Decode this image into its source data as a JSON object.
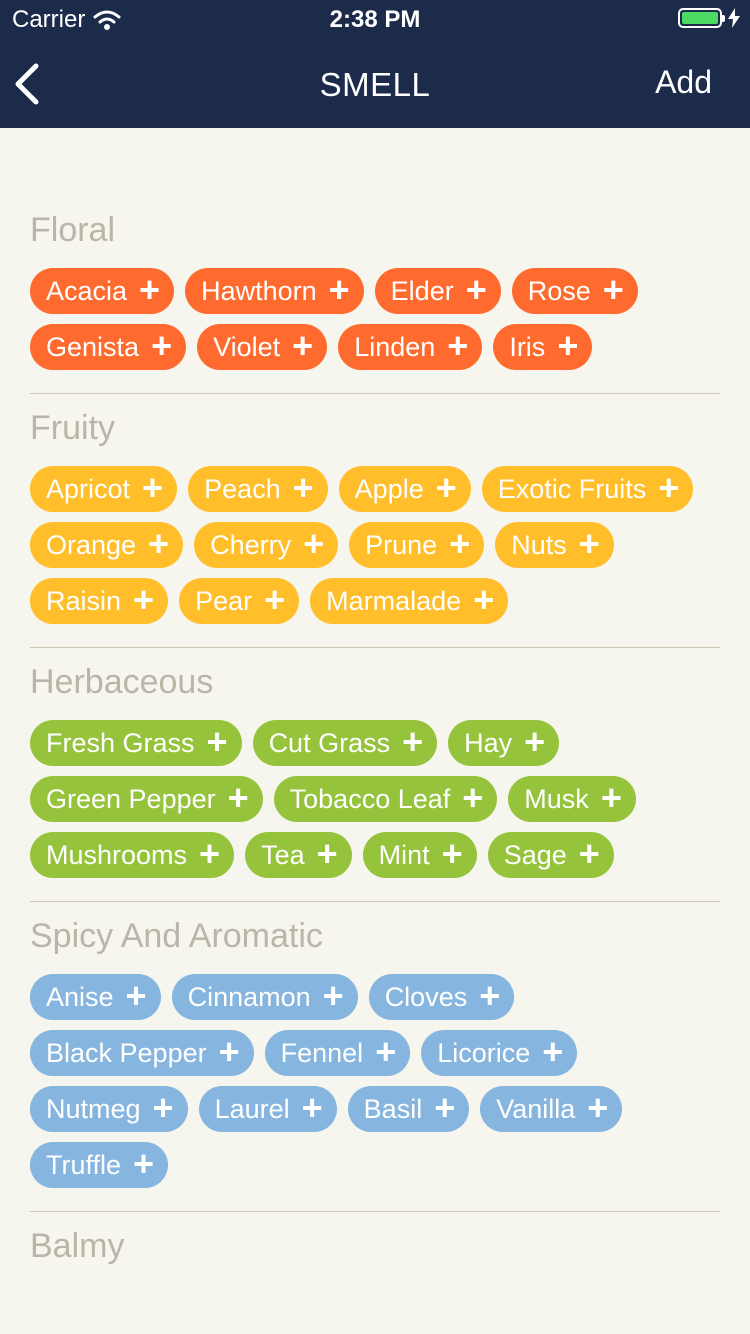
{
  "status_bar": {
    "carrier": "Carrier",
    "time": "2:38 PM",
    "battery_level": 1.0,
    "battery_color": "#4cd964"
  },
  "nav": {
    "title": "SMELL",
    "back_icon": "chevron-left-icon",
    "add_label": "Add",
    "background": "#1c2b4a"
  },
  "sections": [
    {
      "title": "Floral",
      "color": "#ff6a2f",
      "tags": [
        "Acacia",
        "Hawthorn",
        "Elder",
        "Rose",
        "Genista",
        "Violet",
        "Linden",
        "Iris"
      ]
    },
    {
      "title": "Fruity",
      "color": "#ffbe2a",
      "tags": [
        "Apricot",
        "Peach",
        "Apple",
        "Exotic Fruits",
        "Orange",
        "Cherry",
        "Prune",
        "Nuts",
        "Raisin",
        "Pear",
        "Marmalade"
      ]
    },
    {
      "title": "Herbaceous",
      "color": "#96c33c",
      "tags": [
        "Fresh Grass",
        "Cut Grass",
        "Hay",
        "Green Pepper",
        "Tobacco Leaf",
        "Musk",
        "Mushrooms",
        "Tea",
        "Mint",
        "Sage"
      ]
    },
    {
      "title": "Spicy And Aromatic",
      "color": "#86b5df",
      "tags": [
        "Anise",
        "Cinnamon",
        "Cloves",
        "Black Pepper",
        "Fennel",
        "Licorice",
        "Nutmeg",
        "Laurel",
        "Basil",
        "Vanilla",
        "Truffle"
      ]
    },
    {
      "title": "Balmy",
      "tags": []
    }
  ]
}
